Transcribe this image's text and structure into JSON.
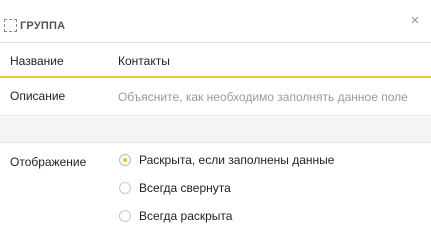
{
  "header": {
    "title": "ГРУППА",
    "group_icon": "dashed-square-icon",
    "close_icon": "close-icon",
    "close_glyph": "×"
  },
  "fields": {
    "name": {
      "label": "Название",
      "value": "Контакты"
    },
    "description": {
      "label": "Описание",
      "value": "",
      "placeholder": "Объясните, как необходимо заполнять данное поле"
    }
  },
  "display": {
    "label": "Отображение",
    "options": [
      {
        "label": "Раскрыта, если заполнены данные",
        "selected": true
      },
      {
        "label": "Всегда свернута",
        "selected": false
      },
      {
        "label": "Всегда раскрыта",
        "selected": false
      }
    ]
  },
  "colors": {
    "accent": "#f3c82f",
    "radio_selected": "#f0c419",
    "divider": "#e2e2e2",
    "spacer_bg": "#f4f4f4"
  }
}
